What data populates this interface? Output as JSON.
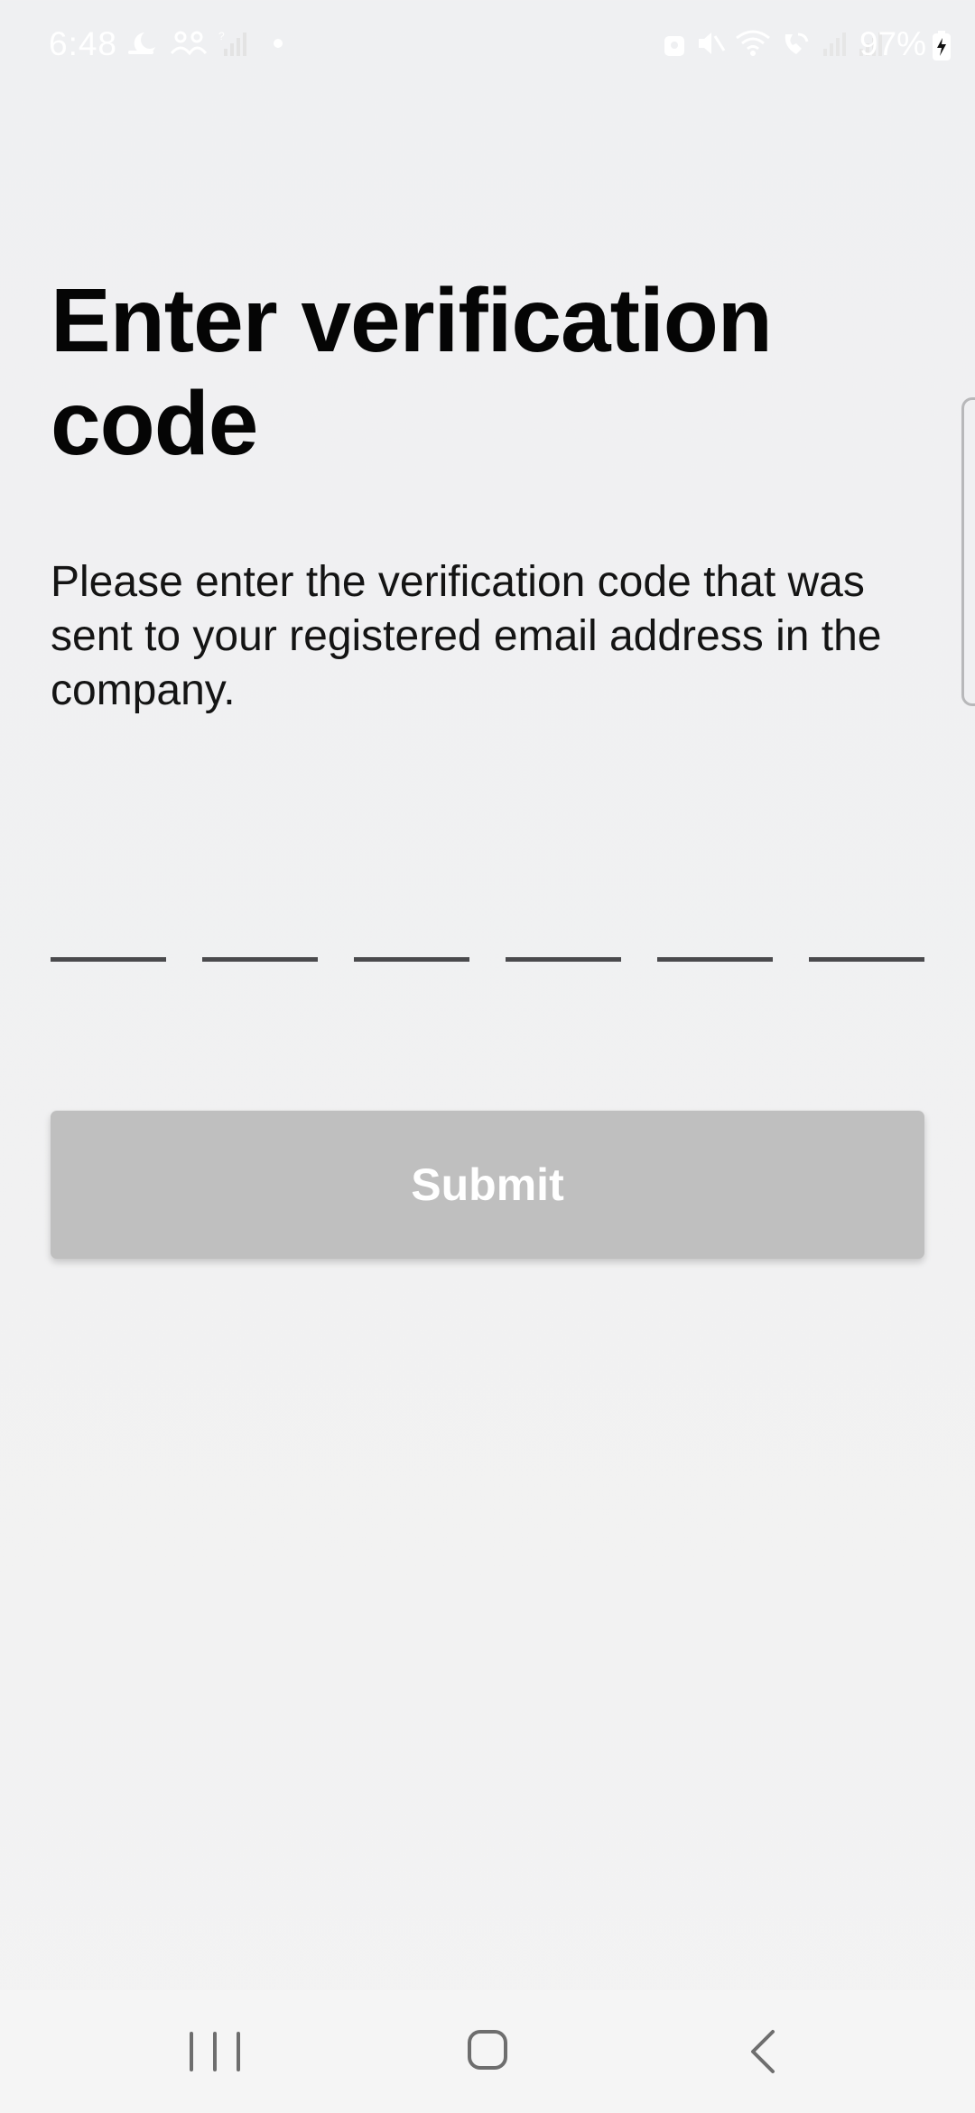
{
  "status_bar": {
    "time": "6:48",
    "battery_percent": "97%",
    "left_icons": [
      "moon-icon",
      "people-icon",
      "signal-question-icon",
      "dot-icon"
    ],
    "right_icons": [
      "lock-icon",
      "mute-icon",
      "wifi-icon",
      "wifi-call-icon",
      "signal-icon",
      "signal-icon",
      "battery-charging-icon"
    ]
  },
  "main": {
    "title": "Enter verification code",
    "description": "Please enter the verification code that was sent to your registered email address in the company.",
    "code_inputs": [
      {
        "value": ""
      },
      {
        "value": ""
      },
      {
        "value": ""
      },
      {
        "value": ""
      },
      {
        "value": ""
      },
      {
        "value": ""
      }
    ],
    "submit_label": "Submit"
  },
  "colors": {
    "background": "#eff0f2",
    "submit_disabled": "#bfbfbf",
    "underline": "#4a4a4d",
    "nav_icons": "#6e6e6e"
  },
  "nav_bar": {
    "buttons": [
      "recents-icon",
      "home-icon",
      "back-icon"
    ]
  }
}
